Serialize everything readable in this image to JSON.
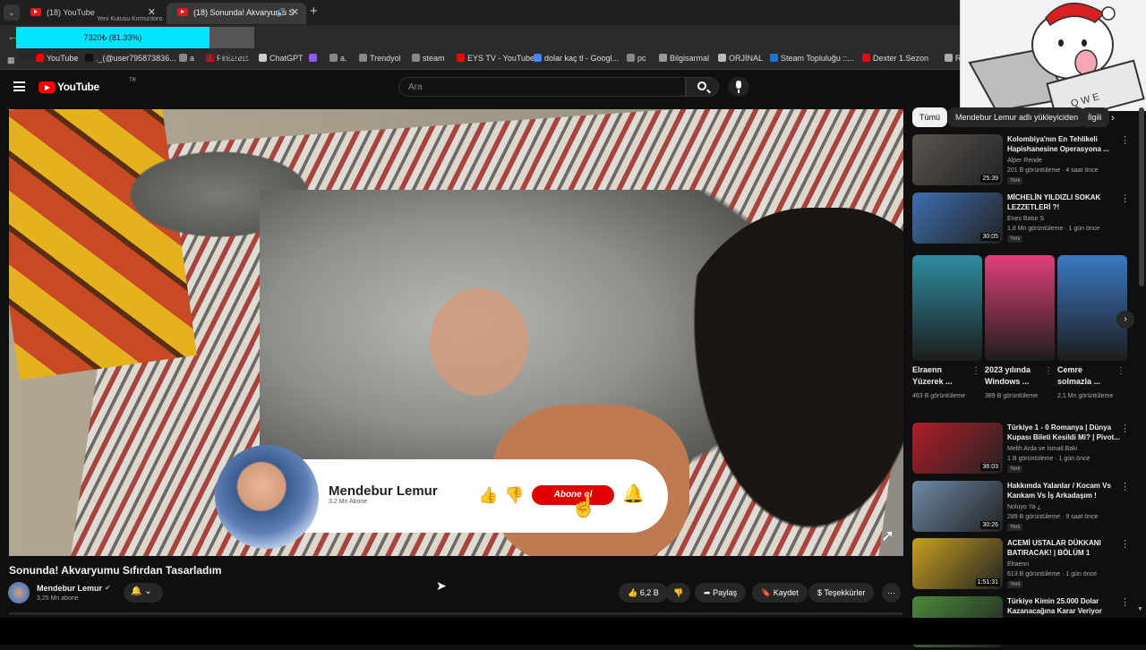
{
  "browser": {
    "tabs": [
      {
        "label": "(18) YouTube"
      },
      {
        "label": "(18) Sonunda! Akvaryumu S",
        "active": true
      }
    ],
    "tab_overlay_text": "Yeni Kutusu Kırmızıtoro",
    "progress": {
      "text": "7320₺ (81.33%)",
      "fraction": 0.8133
    },
    "overlay_9000": "TRY/9000",
    "overlay_try": "TRY"
  },
  "bookmarks": [
    {
      "label": "YouTube",
      "color": "#ff0000"
    },
    {
      "label": "._(@user795873836...",
      "color": "#111111"
    },
    {
      "label": "a",
      "color": "#888888"
    },
    {
      "label": "Pinterest",
      "color": "#e60023"
    },
    {
      "label": "ChatGPT",
      "color": "#cccccc"
    },
    {
      "label": "",
      "color": "#8a5cf6"
    },
    {
      "label": "a.",
      "color": "#888888"
    },
    {
      "label": "Trendyol",
      "color": "#888888"
    },
    {
      "label": "steam",
      "color": "#888888"
    },
    {
      "label": "EYS TV - YouTube",
      "color": "#ff0000"
    },
    {
      "label": "dolar kaç tl - Googl...",
      "color": "#4285f4"
    },
    {
      "label": "pc",
      "color": "#888888"
    },
    {
      "label": "Bilgisarmal",
      "color": "#999999"
    },
    {
      "label": "ORJİNAL",
      "color": "#bbbbbb"
    },
    {
      "label": "Steam Topluluğu ::...",
      "color": "#1b74d3"
    },
    {
      "label": "Dexter 1.Sezon",
      "color": "#e50914"
    },
    {
      "label": "RDR",
      "color": "#aaaaaa"
    }
  ],
  "masthead": {
    "logo": "YouTube",
    "country": "TR",
    "search_placeholder": "Ara"
  },
  "video": {
    "title": "Sonunda! Akvaryumu Sıfırdan Tasarladım",
    "channel": "Mendebur Lemur",
    "channel_subs": "3,25 Mn abone",
    "likes": "6,2 B",
    "share": "Paylaş",
    "save": "Kaydet",
    "thanks": "Teşekkürler"
  },
  "subscribe_card": {
    "name": "Mendebur Lemur",
    "subs": "3,2 Mn Abone",
    "button": "Abone ol"
  },
  "chips": [
    "Tümü",
    "Mendebur Lemur adlı yükleyiciden",
    "İlgili"
  ],
  "recommendations": [
    {
      "title": "Kolombiya'nın En Tehlikeli Hapishanesine Operasyona ...",
      "channel": "Alper Rende",
      "meta": "201 B görüntüleme · 4 saat önce",
      "badge": "Yeni",
      "duration": "25:39",
      "color": "#5a5550"
    },
    {
      "title": "MİCHELİN YILDIZLI SOKAK LEZZETLERİ ?!",
      "channel": "Enes Batur S",
      "meta": "1,8 Mn görüntüleme · 1 gün önce",
      "badge": "Yeni",
      "duration": "30:05",
      "color": "#3e6fb0"
    },
    {
      "title": "Türkiye 1 - 0 Romanya | Dünya Kupası Bileti Kesildi Mi? | Pivot...",
      "channel": "Melih Arda ve İsmail Baki",
      "meta": "1 B görüntüleme · 1 gün önce",
      "badge": "Yeni",
      "duration": "36:03",
      "color": "#b31d2a"
    },
    {
      "title": "Hakkımda Yalanlar / Kocam Vs Kankam Vs İş Arkadaşım !",
      "channel": "Noluyo Ya ¿",
      "meta": "289 B görüntüleme · 9 saat önce",
      "badge": "Yeni",
      "duration": "30:26",
      "color": "#6e8aa6"
    },
    {
      "title": "ACEMİ USTALAR DÜKKANI BATIRACAK! | BÖLÜM 1",
      "channel": "Elraenn",
      "meta": "613 B görüntüleme · 1 gün önce",
      "badge": "Yeni",
      "duration": "1:51:31",
      "color": "#c8a020"
    },
    {
      "title": "Türkiye Kimin 25.000 Dolar Kazanacağına Karar Veriyor",
      "channel": "",
      "meta": "",
      "badge": "",
      "duration": "",
      "color": "#4a8a3a"
    }
  ],
  "shorts": [
    {
      "title": "Elraenn Yüzerek ...",
      "views": "463 B görüntüleme",
      "color": "#2e8ca0"
    },
    {
      "title": "2023 yılında Windows ...",
      "views": "389 B görüntüleme",
      "color": "#e0407a"
    },
    {
      "title": "Cemre solmazla ...",
      "views": "2,1 Mn görüntüleme",
      "color": "#3a78c4"
    }
  ]
}
